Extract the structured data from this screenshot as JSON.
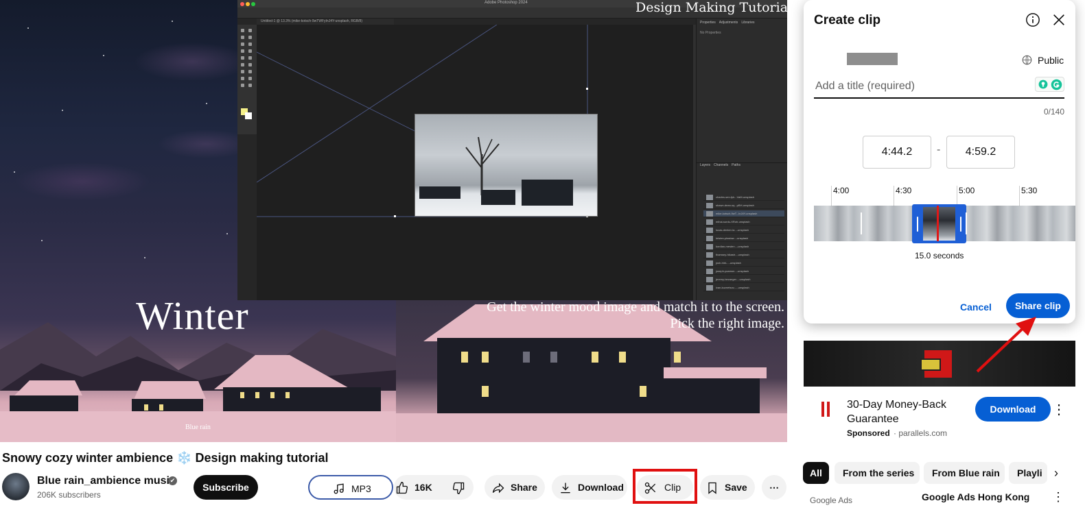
{
  "video": {
    "overlay_title": "Design Making Tutorial",
    "winter_text": "Winter",
    "watermark": "Blue rain",
    "caption_line1": "Get the winter mood image and match it to the screen.",
    "caption_line2": "Pick the right image.",
    "photoshop": {
      "app_title": "Adobe Photoshop 2024",
      "tab": "Untitled-1 @ 13.3% (mike-kotsch-9wTWFyInJ4Y-unsplash, RGB/8)",
      "panel_tabs": [
        "Properties",
        "Adjustments",
        "Libraries"
      ],
      "panel_sub": "No Properties",
      "layer_tabs": [
        "Layers",
        "Channels",
        "Paths"
      ],
      "layers": [
        "charles-sen-fpk...VaM-unsplash",
        "shawn-dean-sq...pBH-unsplash",
        "mike-kotsch-9wT...InJ4Y-unsplash",
        "mihai-surdu-XRoh-unsplash",
        "lucas-denker-la...-unsplash",
        "kristen-plastow...-unsplash",
        "kordian-mesten...-unsplash",
        "thamsey-hikastr...-unsplash",
        "josh-hild-...-unsplash",
        "joseph-yoamon...-unsplash",
        "jeremy-bezanger...-unsplash",
        "ivan-kuznetsov-...-unsplash"
      ]
    }
  },
  "title": "Snowy cozy winter ambience ❄️ Design making tutorial",
  "channel": {
    "name": "Blue rain_ambience music",
    "subscribers": "206K subscribers",
    "verified_icon": "✔"
  },
  "actions": {
    "subscribe": "Subscribe",
    "mp3": "MP3",
    "likes": "16K",
    "share": "Share",
    "download": "Download",
    "clip": "Clip",
    "save": "Save",
    "more": "⋯"
  },
  "ad": {
    "title": "30-Day Money-Back Guarantee",
    "sponsored": "Sponsored",
    "domain": "· parallels.com",
    "download": "Download",
    "more": "⋮"
  },
  "chips": [
    "All",
    "From the series",
    "From Blue rain",
    "Playli"
  ],
  "chip_next": "›",
  "google_ads": {
    "logo": "Google Ads",
    "title": "Google Ads Hong Kong",
    "more": "⋮"
  },
  "dialog": {
    "title": "Create clip",
    "visibility": "Public",
    "title_placeholder": "Add a title (required)",
    "char_count": "0/140",
    "start_time": "4:44.2",
    "end_time": "4:59.2",
    "separator": "-",
    "timeline_labels": [
      "4:00",
      "4:30",
      "5:00",
      "5:30"
    ],
    "duration": "15.0 seconds",
    "cancel": "Cancel",
    "share": "Share clip"
  },
  "colors": {
    "accent": "#065fd4",
    "highlight": "#e01010",
    "selection": "#1f5fd6"
  }
}
